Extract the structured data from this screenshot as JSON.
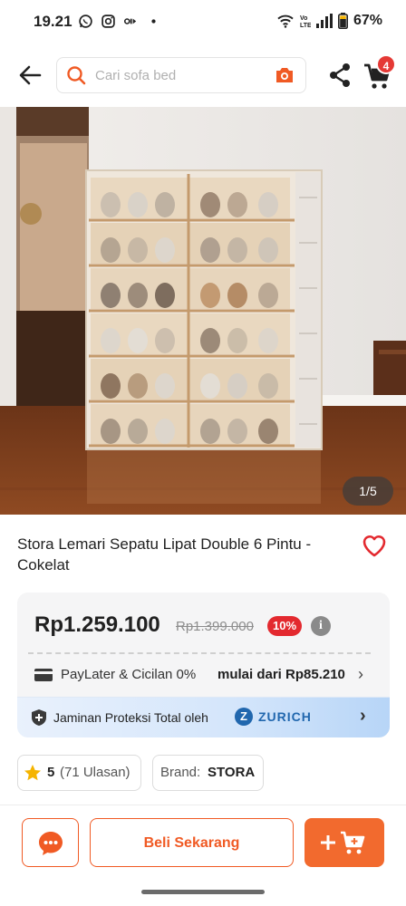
{
  "status_bar": {
    "time": "19.21",
    "battery": "67%",
    "icons": [
      "whatsapp-icon",
      "instagram-icon",
      "notification-icon",
      "wifi-icon",
      "volte-icon",
      "signal-icon",
      "battery-icon"
    ]
  },
  "header": {
    "search_placeholder": "Cari sofa bed",
    "cart_count": "4",
    "icons": [
      "back-arrow-icon",
      "search-icon",
      "camera-icon",
      "share-icon",
      "cart-icon"
    ]
  },
  "gallery": {
    "counter": "1/5"
  },
  "product": {
    "title": "Stora Lemari Sepatu Lipat Double 6 Pintu - Cokelat"
  },
  "price": {
    "current": "Rp1.259.100",
    "original": "Rp1.399.000",
    "discount": "10%",
    "info_glyph": "i"
  },
  "paylater": {
    "label": "PayLater & Cicilan 0%",
    "value": "mulai dari Rp85.210",
    "chevron": "›"
  },
  "protection": {
    "label": "Jaminan Proteksi Total oleh",
    "partner_mark": "Z",
    "partner": "ZURICH",
    "chevron": "›"
  },
  "rating": {
    "score": "5",
    "reviews": "(71 Ulasan)"
  },
  "brand": {
    "label": "Brand:",
    "value": "STORA"
  },
  "actions": {
    "buy_now": "Beli Sekarang"
  },
  "colors": {
    "accent": "#f05a24",
    "badge_red": "#e3292f",
    "zurich_blue": "#2167ae"
  }
}
